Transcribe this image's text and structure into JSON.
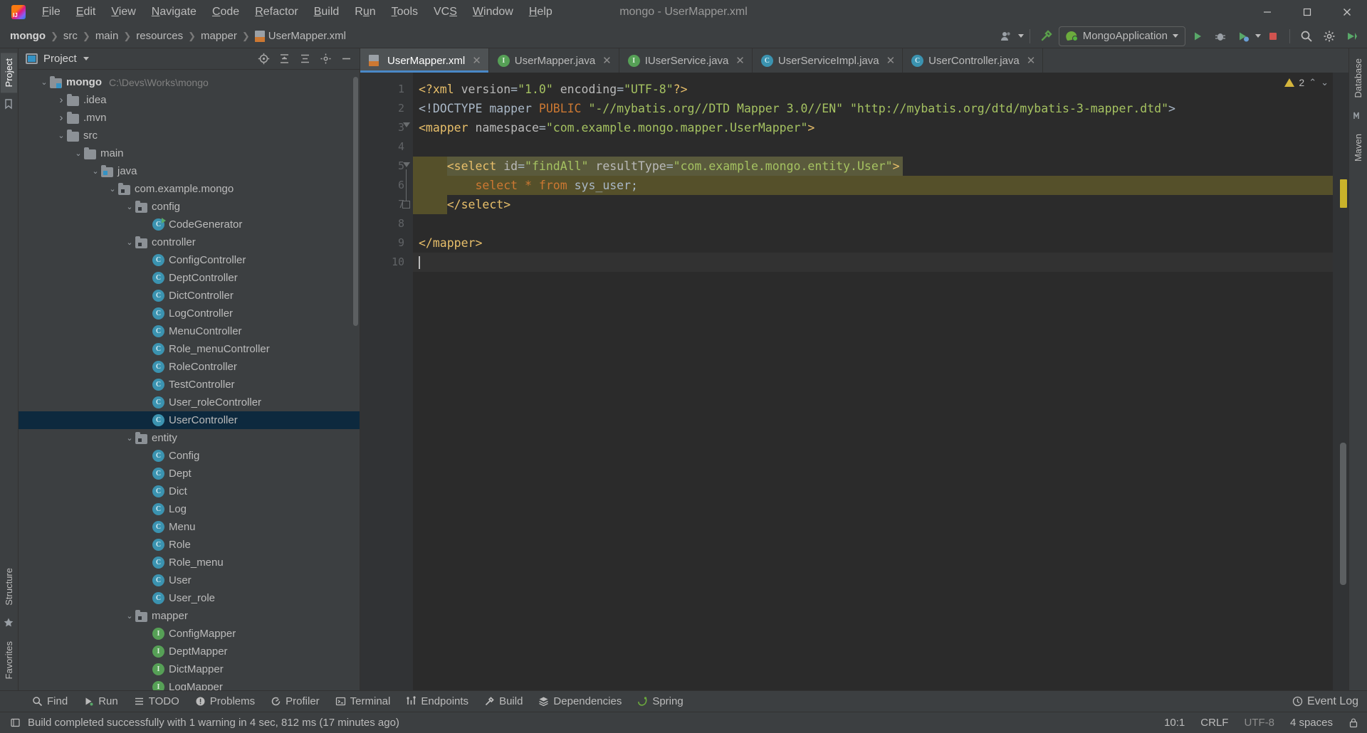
{
  "window": {
    "title": "mongo - UserMapper.xml",
    "controls": [
      "minimize",
      "maximize",
      "close"
    ]
  },
  "menubar": {
    "items": [
      {
        "label": "File",
        "mnemonic": "F"
      },
      {
        "label": "Edit",
        "mnemonic": "E"
      },
      {
        "label": "View",
        "mnemonic": "V"
      },
      {
        "label": "Navigate",
        "mnemonic": "N"
      },
      {
        "label": "Code",
        "mnemonic": "C"
      },
      {
        "label": "Refactor",
        "mnemonic": "R"
      },
      {
        "label": "Build",
        "mnemonic": "B"
      },
      {
        "label": "Run",
        "mnemonic": "u"
      },
      {
        "label": "Tools",
        "mnemonic": "T"
      },
      {
        "label": "VCS",
        "mnemonic": "S"
      },
      {
        "label": "Window",
        "mnemonic": "W"
      },
      {
        "label": "Help",
        "mnemonic": "H"
      }
    ]
  },
  "navbar": {
    "breadcrumbs": [
      "mongo",
      "src",
      "main",
      "resources",
      "mapper",
      "UserMapper.xml"
    ],
    "run_config": "MongoApplication",
    "icons": [
      "user-avatar-icon",
      "hammer-build-icon",
      "run-icon",
      "debug-icon",
      "coverage-icon",
      "profile-icon",
      "stop-icon",
      "search-everywhere-icon",
      "settings-icon",
      "updates-icon"
    ]
  },
  "project_panel": {
    "title": "Project",
    "header_icons": [
      "locate-icon",
      "collapse-all-icon",
      "expand-all-icon",
      "settings-icon",
      "hide-icon"
    ],
    "tree": [
      {
        "label": "mongo",
        "path": "C:\\Devs\\Works\\mongo",
        "depth": 0,
        "icon": "module-folder",
        "state": "expanded",
        "bold": true
      },
      {
        "label": ".idea",
        "depth": 1,
        "icon": "folder",
        "state": "collapsed"
      },
      {
        "label": ".mvn",
        "depth": 1,
        "icon": "folder",
        "state": "collapsed"
      },
      {
        "label": "src",
        "depth": 1,
        "icon": "folder",
        "state": "expanded"
      },
      {
        "label": "main",
        "depth": 2,
        "icon": "folder",
        "state": "expanded"
      },
      {
        "label": "java",
        "depth": 3,
        "icon": "source-folder",
        "state": "expanded"
      },
      {
        "label": "com.example.mongo",
        "depth": 4,
        "icon": "package",
        "state": "expanded"
      },
      {
        "label": "config",
        "depth": 5,
        "icon": "package",
        "state": "expanded"
      },
      {
        "label": "CodeGenerator",
        "depth": 6,
        "icon": "class-runnable",
        "state": "leaf"
      },
      {
        "label": "controller",
        "depth": 5,
        "icon": "package",
        "state": "expanded"
      },
      {
        "label": "ConfigController",
        "depth": 6,
        "icon": "class",
        "state": "leaf"
      },
      {
        "label": "DeptController",
        "depth": 6,
        "icon": "class",
        "state": "leaf"
      },
      {
        "label": "DictController",
        "depth": 6,
        "icon": "class",
        "state": "leaf"
      },
      {
        "label": "LogController",
        "depth": 6,
        "icon": "class",
        "state": "leaf"
      },
      {
        "label": "MenuController",
        "depth": 6,
        "icon": "class",
        "state": "leaf"
      },
      {
        "label": "Role_menuController",
        "depth": 6,
        "icon": "class",
        "state": "leaf"
      },
      {
        "label": "RoleController",
        "depth": 6,
        "icon": "class",
        "state": "leaf"
      },
      {
        "label": "TestController",
        "depth": 6,
        "icon": "class",
        "state": "leaf"
      },
      {
        "label": "User_roleController",
        "depth": 6,
        "icon": "class",
        "state": "leaf"
      },
      {
        "label": "UserController",
        "depth": 6,
        "icon": "class",
        "state": "leaf",
        "selected": true
      },
      {
        "label": "entity",
        "depth": 5,
        "icon": "package",
        "state": "expanded"
      },
      {
        "label": "Config",
        "depth": 6,
        "icon": "class",
        "state": "leaf"
      },
      {
        "label": "Dept",
        "depth": 6,
        "icon": "class",
        "state": "leaf"
      },
      {
        "label": "Dict",
        "depth": 6,
        "icon": "class",
        "state": "leaf"
      },
      {
        "label": "Log",
        "depth": 6,
        "icon": "class",
        "state": "leaf"
      },
      {
        "label": "Menu",
        "depth": 6,
        "icon": "class",
        "state": "leaf"
      },
      {
        "label": "Role",
        "depth": 6,
        "icon": "class",
        "state": "leaf"
      },
      {
        "label": "Role_menu",
        "depth": 6,
        "icon": "class",
        "state": "leaf"
      },
      {
        "label": "User",
        "depth": 6,
        "icon": "class",
        "state": "leaf"
      },
      {
        "label": "User_role",
        "depth": 6,
        "icon": "class",
        "state": "leaf"
      },
      {
        "label": "mapper",
        "depth": 5,
        "icon": "package",
        "state": "expanded"
      },
      {
        "label": "ConfigMapper",
        "depth": 6,
        "icon": "interface",
        "state": "leaf"
      },
      {
        "label": "DeptMapper",
        "depth": 6,
        "icon": "interface",
        "state": "leaf"
      },
      {
        "label": "DictMapper",
        "depth": 6,
        "icon": "interface",
        "state": "leaf"
      },
      {
        "label": "LogMapper",
        "depth": 6,
        "icon": "interface",
        "state": "leaf"
      }
    ]
  },
  "left_rail": {
    "tabs": [
      "Project",
      "Structure",
      "Favorites"
    ]
  },
  "right_rail": {
    "tabs": [
      "Database",
      "Maven"
    ]
  },
  "editor": {
    "tabs": [
      {
        "label": "UserMapper.xml",
        "icon": "xml-file-icon",
        "active": true
      },
      {
        "label": "UserMapper.java",
        "icon": "interface",
        "active": false
      },
      {
        "label": "IUserService.java",
        "icon": "interface",
        "active": false
      },
      {
        "label": "UserServiceImpl.java",
        "icon": "class",
        "active": false
      },
      {
        "label": "UserController.java",
        "icon": "class",
        "active": false
      }
    ],
    "line_numbers": [
      "1",
      "2",
      "3",
      "4",
      "5",
      "6",
      "7",
      "8",
      "9",
      "10"
    ],
    "lines": [
      {
        "n": 1,
        "segments": [
          {
            "t": "<?xml ",
            "c": "tok-pi"
          },
          {
            "t": "version",
            "c": "tok-attr"
          },
          {
            "t": "=",
            "c": "tok-punct"
          },
          {
            "t": "\"1.0\"",
            "c": "tok-val"
          },
          {
            "t": " ",
            "c": "tok-plain"
          },
          {
            "t": "encoding",
            "c": "tok-attr"
          },
          {
            "t": "=",
            "c": "tok-punct"
          },
          {
            "t": "\"UTF-8\"",
            "c": "tok-val"
          },
          {
            "t": "?>",
            "c": "tok-pi"
          }
        ]
      },
      {
        "n": 2,
        "segments": [
          {
            "t": "<!DOCTYPE ",
            "c": "tok-plain"
          },
          {
            "t": "mapper ",
            "c": "tok-plain"
          },
          {
            "t": "PUBLIC",
            "c": "tok-kw"
          },
          {
            "t": " ",
            "c": "tok-plain"
          },
          {
            "t": "\"-//mybatis.org//DTD Mapper 3.0//EN\"",
            "c": "tok-val"
          },
          {
            "t": " ",
            "c": "tok-plain"
          },
          {
            "t": "\"http://mybatis.org/dtd/mybatis-3-mapper.dtd\"",
            "c": "tok-val"
          },
          {
            "t": ">",
            "c": "tok-plain"
          }
        ]
      },
      {
        "n": 3,
        "segments": [
          {
            "t": "<mapper ",
            "c": "tok-tag"
          },
          {
            "t": "namespace",
            "c": "tok-attr"
          },
          {
            "t": "=",
            "c": "tok-punct"
          },
          {
            "t": "\"com.example.mongo.mapper.UserMapper\"",
            "c": "tok-val"
          },
          {
            "t": ">",
            "c": "tok-tag"
          }
        ]
      },
      {
        "n": 4,
        "segments": []
      },
      {
        "n": 5,
        "segments": [
          {
            "t": "    ",
            "c": "tok-plain"
          },
          {
            "t": "<select ",
            "c": "tok-tag"
          },
          {
            "t": "id",
            "c": "tok-attr"
          },
          {
            "t": "=",
            "c": "tok-punct"
          },
          {
            "t": "\"findAll\"",
            "c": "tok-val"
          },
          {
            "t": " ",
            "c": "tok-plain"
          },
          {
            "t": "resultType",
            "c": "tok-attr"
          },
          {
            "t": "=",
            "c": "tok-punct"
          },
          {
            "t": "\"com.example.mongo.entity.User\"",
            "c": "tok-val"
          },
          {
            "t": ">",
            "c": "tok-tag"
          }
        ]
      },
      {
        "n": 6,
        "segments": [
          {
            "t": "        ",
            "c": "tok-plain"
          },
          {
            "t": "select ",
            "c": "tok-sql-kw"
          },
          {
            "t": "* ",
            "c": "tok-sql-kw"
          },
          {
            "t": "from ",
            "c": "tok-sql-kw"
          },
          {
            "t": "sys_user;",
            "c": "tok-sql-plain"
          }
        ]
      },
      {
        "n": 7,
        "segments": [
          {
            "t": "    ",
            "c": "tok-plain"
          },
          {
            "t": "</select>",
            "c": "tok-tag"
          }
        ]
      },
      {
        "n": 8,
        "segments": []
      },
      {
        "n": 9,
        "segments": [
          {
            "t": "</mapper>",
            "c": "tok-tag"
          }
        ]
      },
      {
        "n": 10,
        "segments": []
      }
    ],
    "inspection_count": "2"
  },
  "bottombar": {
    "items": [
      {
        "label": "Find",
        "icon": "search-icon"
      },
      {
        "label": "Run",
        "icon": "run-icon"
      },
      {
        "label": "TODO",
        "icon": "todo-icon"
      },
      {
        "label": "Problems",
        "icon": "problems-icon"
      },
      {
        "label": "Profiler",
        "icon": "profiler-icon"
      },
      {
        "label": "Terminal",
        "icon": "terminal-icon"
      },
      {
        "label": "Endpoints",
        "icon": "endpoints-icon"
      },
      {
        "label": "Build",
        "icon": "hammer-build-icon"
      },
      {
        "label": "Dependencies",
        "icon": "dependencies-icon"
      },
      {
        "label": "Spring",
        "icon": "spring-icon"
      }
    ],
    "event_log": "Event Log"
  },
  "statusbar": {
    "message": "Build completed successfully with 1 warning in 4 sec, 812 ms (17 minutes ago)",
    "caret_position": "10:1",
    "line_separator": "CRLF",
    "encoding": "UTF-8",
    "indent": "4 spaces",
    "lock_icon": "lock-icon"
  },
  "colors": {
    "background": "#3c3f41",
    "editor_background": "#2b2b2b",
    "accent": "#4a88c7",
    "selection": "#0d293e",
    "injection_highlight": "#55502a",
    "string": "#a5c261",
    "tag": "#e8bf6a",
    "keyword": "#cc7832"
  }
}
